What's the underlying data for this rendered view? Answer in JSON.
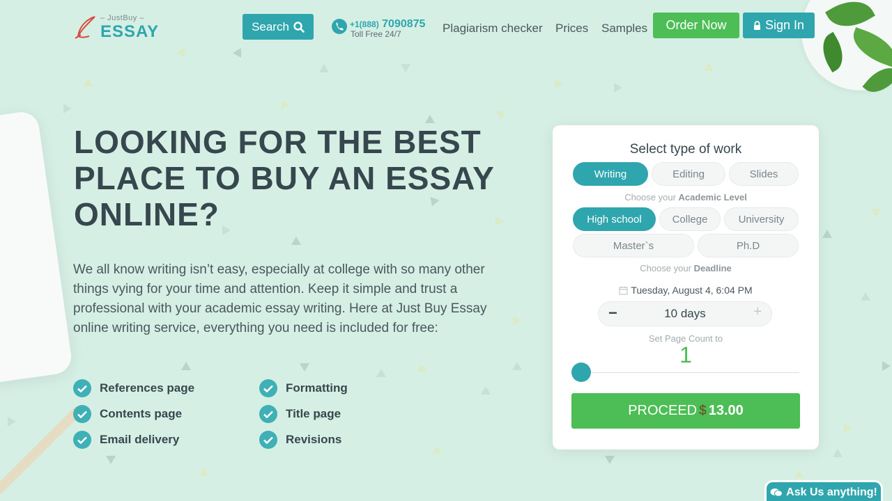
{
  "header": {
    "logo": {
      "top": "– JustBuy –",
      "main": "ESSAY"
    },
    "search_label": "Search",
    "phone": {
      "prefix": "+1(888)",
      "number": "7090875",
      "sub": "Toll Free 24/7"
    },
    "nav": [
      "Plagiarism checker",
      "Prices",
      "Samples"
    ],
    "order_label": "Order Now",
    "signin_label": "Sign In"
  },
  "hero": {
    "title": "LOOKING FOR THE BEST PLACE TO BUY AN ESSAY ONLINE?",
    "text": "We all know writing isn’t easy, especially at college with so many other things vying for your time and attention. Keep it simple and trust a professional with your academic essay writing. Here at Just Buy Essay online writing service, everything you need is included for free:",
    "features": [
      "References page",
      "Formatting",
      "Contents page",
      "Title page",
      "Email delivery",
      "Revisions"
    ]
  },
  "order": {
    "title": "Select type of work",
    "work_types": [
      "Writing",
      "Editing",
      "Slides"
    ],
    "level_label_pre": "Choose your",
    "level_label_bold": "Academic Level",
    "levels": [
      "High school",
      "College",
      "University",
      "Master`s",
      "Ph.D"
    ],
    "deadline_label_pre": "Choose your",
    "deadline_label_bold": "Deadline",
    "date": "Tuesday, August 4, 6:04 PM",
    "days": "10 days",
    "pages_label": "Set Page Count to",
    "pages_value": "1",
    "proceed_label": "PROCEED",
    "currency": "$",
    "price": "13.00"
  },
  "chat_label": "Ask Us anything!",
  "colors": {
    "teal": "#2fa6ae",
    "green": "#4dbe55",
    "background": "#d6efe5"
  }
}
